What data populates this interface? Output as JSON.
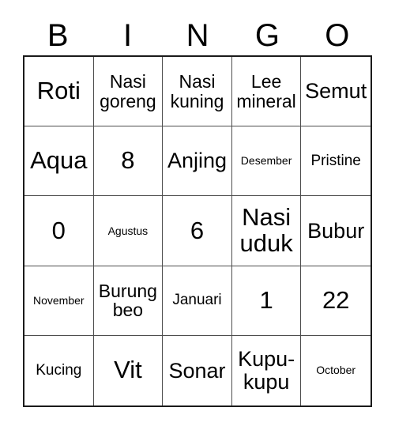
{
  "card": {
    "type": "bingo-card",
    "header_letters": [
      "B",
      "I",
      "N",
      "G",
      "O"
    ],
    "columns": 5,
    "rows": 5,
    "colors": {
      "background": "#ffffff",
      "text": "#000000",
      "outer_border": "#1a1a1a",
      "inner_border": "#4d4d4d"
    },
    "grid": [
      [
        {
          "text": "Roti",
          "size": "fs-xl"
        },
        {
          "text": "Nasi goreng",
          "size": "fs-md"
        },
        {
          "text": "Nasi kuning",
          "size": "fs-md"
        },
        {
          "text": "Lee mineral",
          "size": "fs-md"
        },
        {
          "text": "Semut",
          "size": "fs-lg"
        }
      ],
      [
        {
          "text": "Aqua",
          "size": "fs-xl"
        },
        {
          "text": "8",
          "size": "fs-num"
        },
        {
          "text": "Anjing",
          "size": "fs-lg"
        },
        {
          "text": "Desember",
          "size": "fs-xs"
        },
        {
          "text": "Pristine",
          "size": "fs-sm"
        }
      ],
      [
        {
          "text": "0",
          "size": "fs-num"
        },
        {
          "text": "Agustus",
          "size": "fs-xs"
        },
        {
          "text": "6",
          "size": "fs-num"
        },
        {
          "text": "Nasi uduk",
          "size": "fs-xl"
        },
        {
          "text": "Bubur",
          "size": "fs-lg"
        }
      ],
      [
        {
          "text": "November",
          "size": "fs-xs"
        },
        {
          "text": "Burung beo",
          "size": "fs-md"
        },
        {
          "text": "Januari",
          "size": "fs-sm"
        },
        {
          "text": "1",
          "size": "fs-num"
        },
        {
          "text": "22",
          "size": "fs-num"
        }
      ],
      [
        {
          "text": "Kucing",
          "size": "fs-sm"
        },
        {
          "text": "Vit",
          "size": "fs-xl"
        },
        {
          "text": "Sonar",
          "size": "fs-lg"
        },
        {
          "text": "Kupu-kupu",
          "size": "fs-lg"
        },
        {
          "text": "October",
          "size": "fs-xs"
        }
      ]
    ]
  }
}
